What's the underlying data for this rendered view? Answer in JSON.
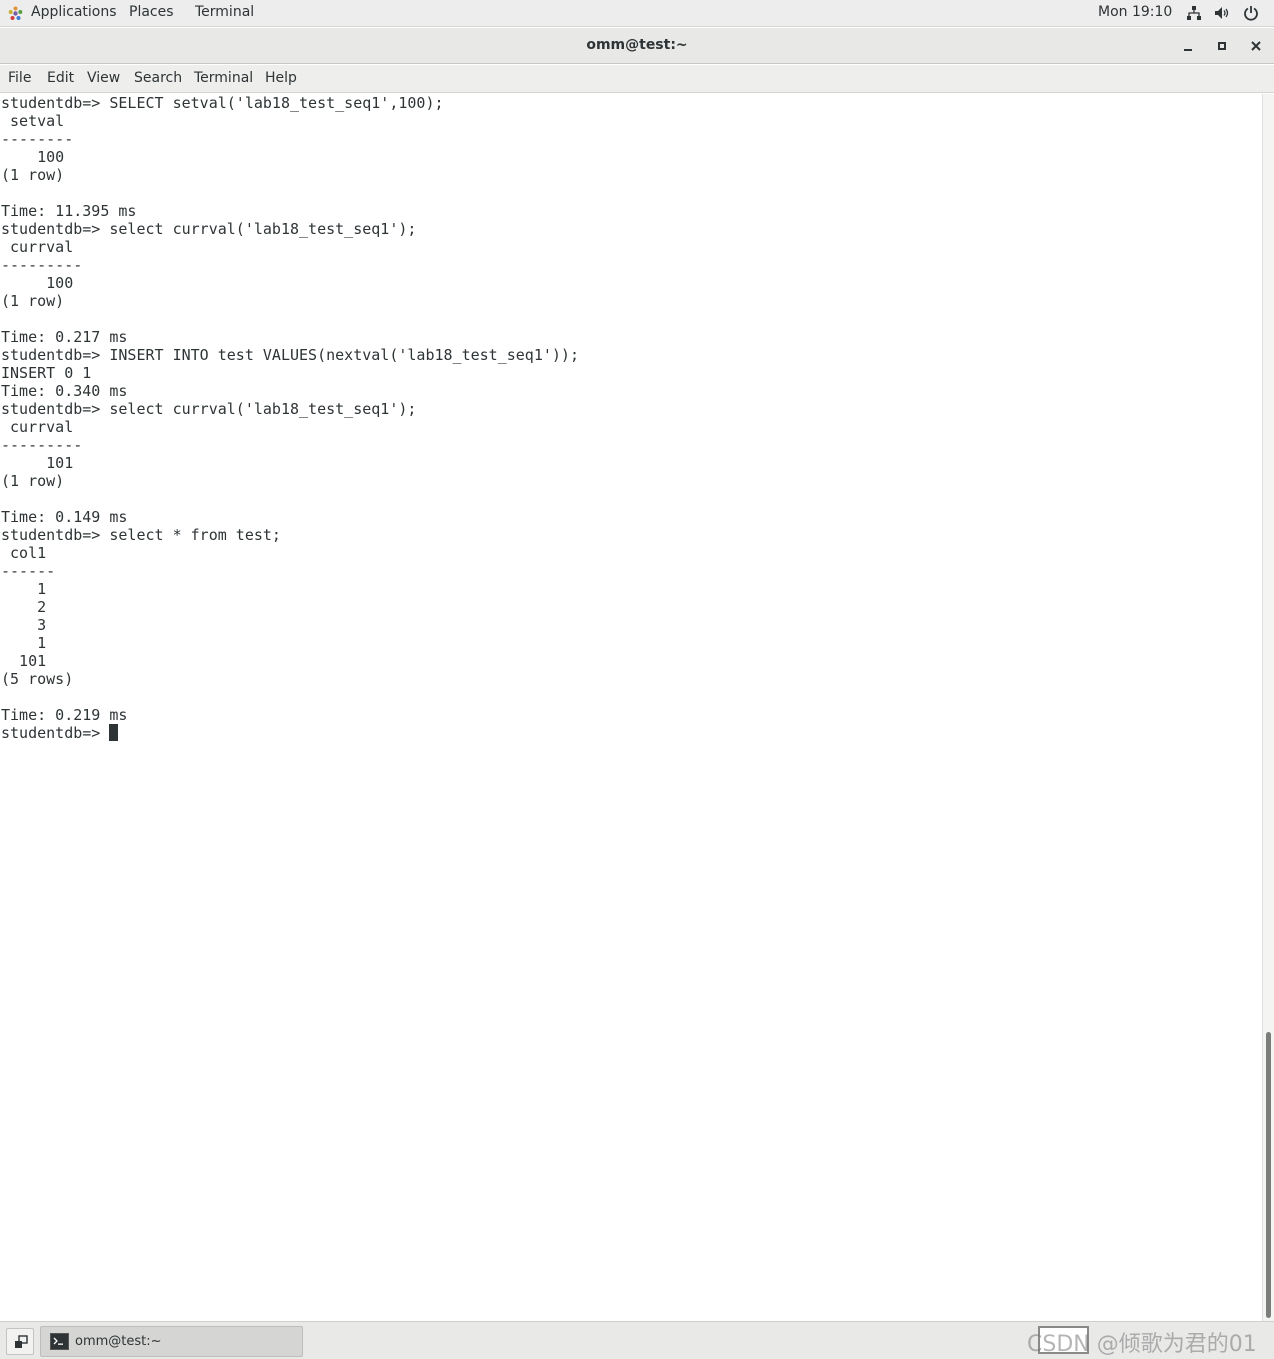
{
  "top_panel": {
    "menus": [
      "Applications",
      "Places",
      "Terminal"
    ],
    "clock": "Mon 19:10",
    "tray_icons": [
      "network-icon",
      "volume-icon",
      "power-icon"
    ]
  },
  "window": {
    "title": "omm@test:~",
    "buttons": [
      "minimize",
      "maximize",
      "close"
    ]
  },
  "menubar": {
    "items": [
      "File",
      "Edit",
      "View",
      "Search",
      "Terminal",
      "Help"
    ]
  },
  "terminal": {
    "lines": [
      "studentdb=> SELECT setval('lab18_test_seq1',100);",
      " setval",
      "--------",
      "    100",
      "(1 row)",
      "",
      "Time: 11.395 ms",
      "studentdb=> select currval('lab18_test_seq1');",
      " currval",
      "---------",
      "     100",
      "(1 row)",
      "",
      "Time: 0.217 ms",
      "studentdb=> INSERT INTO test VALUES(nextval('lab18_test_seq1'));",
      "INSERT 0 1",
      "Time: 0.340 ms",
      "studentdb=> select currval('lab18_test_seq1');",
      " currval",
      "---------",
      "     101",
      "(1 row)",
      "",
      "Time: 0.149 ms",
      "studentdb=> select * from test;",
      " col1",
      "------",
      "    1",
      "    2",
      "    3",
      "    1",
      "  101",
      "(5 rows)",
      "",
      "Time: 0.219 ms"
    ],
    "prompt": "studentdb=> "
  },
  "taskbar": {
    "task_label": "omm@test:~",
    "watermark": "CSDN @倾歌为君的01"
  },
  "colors": {
    "panel_bg": "#ededed",
    "terminal_fg": "#2e3436",
    "terminal_bg": "#ffffff"
  }
}
